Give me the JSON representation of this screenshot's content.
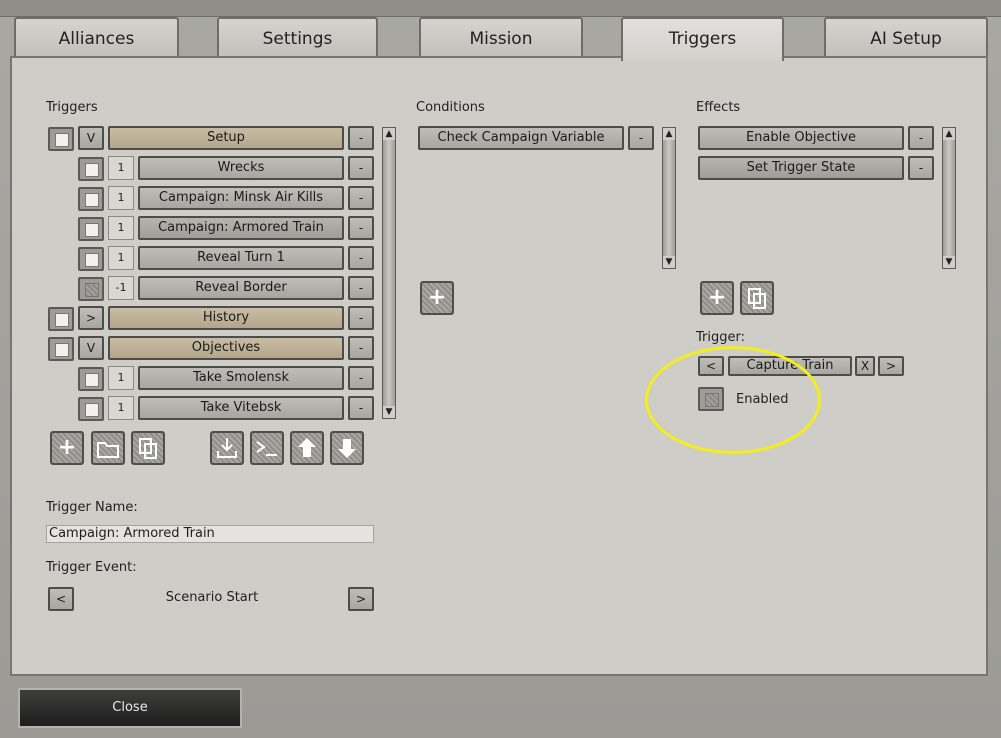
{
  "tabs": [
    {
      "label": "Alliances",
      "active": false
    },
    {
      "label": "Settings",
      "active": false
    },
    {
      "label": "Mission",
      "active": false
    },
    {
      "label": "Triggers",
      "active": true
    },
    {
      "label": "AI Setup",
      "active": false
    }
  ],
  "triggers": {
    "heading": "Triggers",
    "expand_open": "V",
    "expand_closed": ">",
    "remove_label": "-",
    "rows": [
      {
        "name": "Setup",
        "prefix": "V",
        "kind": "group"
      },
      {
        "name": "Wrecks",
        "prefix": "1",
        "kind": "item"
      },
      {
        "name": "Campaign: Minsk Air Kills",
        "prefix": "1",
        "kind": "item"
      },
      {
        "name": "Campaign: Armored Train",
        "prefix": "1",
        "kind": "item",
        "selected": true
      },
      {
        "name": "Reveal Turn 1",
        "prefix": "1",
        "kind": "item"
      },
      {
        "name": "Reveal Border",
        "prefix": "-1",
        "kind": "item",
        "disabled": true
      },
      {
        "name": "History",
        "prefix": ">",
        "kind": "group"
      },
      {
        "name": "Objectives",
        "prefix": "V",
        "kind": "group"
      },
      {
        "name": "Take Smolensk",
        "prefix": "1",
        "kind": "item"
      },
      {
        "name": "Take Vitebsk",
        "prefix": "1",
        "kind": "item"
      }
    ]
  },
  "conditions": {
    "heading": "Conditions",
    "items": [
      "Check Campaign Variable"
    ]
  },
  "effects": {
    "heading": "Effects",
    "items": [
      "Enable Objective",
      "Set Trigger State"
    ]
  },
  "effect_trigger": {
    "label": "Trigger:",
    "prev": "<",
    "value": "Capture Train",
    "clear": "X",
    "next": ">",
    "enabled_label": "Enabled"
  },
  "trigger_name": {
    "label": "Trigger Name:",
    "value": "Campaign: Armored Train"
  },
  "trigger_event": {
    "label": "Trigger Event:",
    "prev": "<",
    "value": "Scenario Start",
    "next": ">"
  },
  "footer": {
    "close_label": "Close"
  },
  "colors": {
    "highlight": "#f4ef1b",
    "group_row": "#c8bda4"
  }
}
